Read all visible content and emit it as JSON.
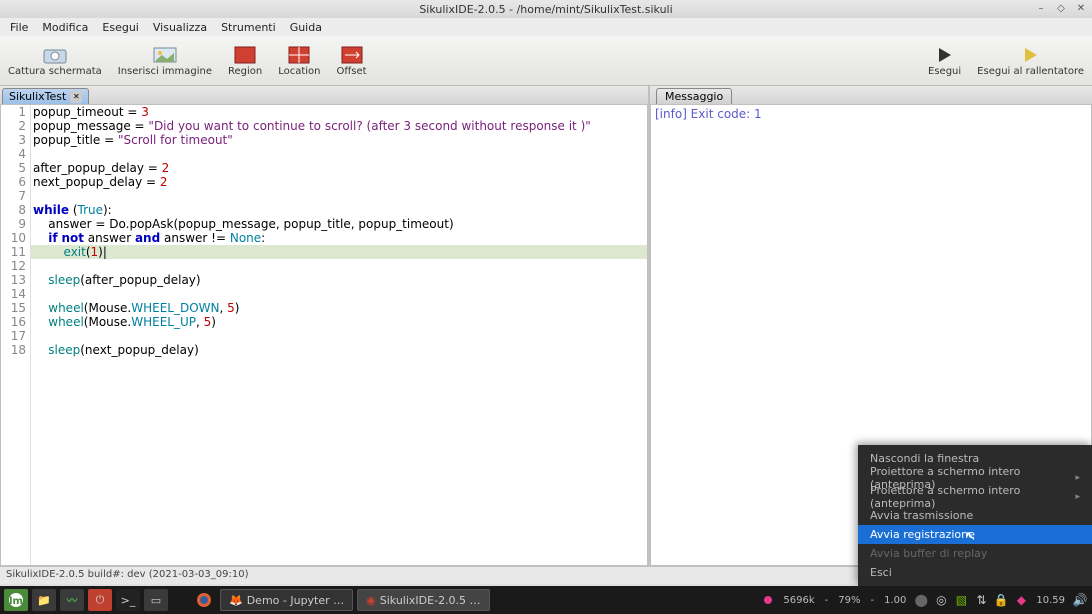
{
  "window": {
    "title": "SikulixIDE-2.0.5 - /home/mint/SikulixTest.sikuli"
  },
  "menubar": [
    "File",
    "Modifica",
    "Esegui",
    "Visualizza",
    "Strumenti",
    "Guida"
  ],
  "toolbar": {
    "capture": "Cattura schermata",
    "insert": "Inserisci immagine",
    "region": "Region",
    "location": "Location",
    "offset": "Offset",
    "run": "Esegui",
    "runslow": "Esegui al rallentatore"
  },
  "tabs": {
    "editor": "SikulixTest",
    "message": "Messaggio"
  },
  "code": {
    "lines": [
      {
        "n": 1,
        "t": [
          [
            "",
            "popup_timeout = "
          ],
          [
            "num",
            "3"
          ]
        ]
      },
      {
        "n": 2,
        "t": [
          [
            "",
            "popup_message = "
          ],
          [
            "str",
            "\"Did you want to continue to scroll? (after 3 second without response it )\""
          ]
        ]
      },
      {
        "n": 3,
        "t": [
          [
            "",
            "popup_title = "
          ],
          [
            "str",
            "\"Scroll for timeout\""
          ]
        ]
      },
      {
        "n": 4,
        "t": [
          [
            "",
            ""
          ]
        ]
      },
      {
        "n": 5,
        "t": [
          [
            "",
            "after_popup_delay = "
          ],
          [
            "num",
            "2"
          ]
        ]
      },
      {
        "n": 6,
        "t": [
          [
            "",
            "next_popup_delay = "
          ],
          [
            "num",
            "2"
          ]
        ]
      },
      {
        "n": 7,
        "t": [
          [
            "",
            ""
          ]
        ]
      },
      {
        "n": 8,
        "t": [
          [
            "kw",
            "while"
          ],
          [
            "",
            " ("
          ],
          [
            "const",
            "True"
          ],
          [
            "",
            "):"
          ]
        ]
      },
      {
        "n": 9,
        "t": [
          [
            "",
            "    answer = Do.popAsk(popup_message, popup_title, popup_timeout)"
          ]
        ]
      },
      {
        "n": 10,
        "t": [
          [
            "",
            "    "
          ],
          [
            "kw",
            "if"
          ],
          [
            "",
            " "
          ],
          [
            "kw",
            "not"
          ],
          [
            "",
            " answer "
          ],
          [
            "kw",
            "and"
          ],
          [
            "",
            " answer != "
          ],
          [
            "const",
            "None"
          ],
          [
            "",
            ":"
          ]
        ]
      },
      {
        "n": 11,
        "t": [
          [
            "",
            "        "
          ],
          [
            "fn",
            "exit"
          ],
          [
            "",
            "("
          ],
          [
            "num",
            "1"
          ],
          [
            "",
            ")|"
          ]
        ],
        "hl": true
      },
      {
        "n": 12,
        "t": [
          [
            "",
            ""
          ]
        ]
      },
      {
        "n": 13,
        "t": [
          [
            "",
            "    "
          ],
          [
            "fn",
            "sleep"
          ],
          [
            "",
            "(after_popup_delay)"
          ]
        ]
      },
      {
        "n": 14,
        "t": [
          [
            "",
            ""
          ]
        ]
      },
      {
        "n": 15,
        "t": [
          [
            "",
            "    "
          ],
          [
            "fn",
            "wheel"
          ],
          [
            "",
            "(Mouse."
          ],
          [
            "const",
            "WHEEL_DOWN"
          ],
          [
            "",
            ", "
          ],
          [
            "num",
            "5"
          ],
          [
            "",
            ")"
          ]
        ]
      },
      {
        "n": 16,
        "t": [
          [
            "",
            "    "
          ],
          [
            "fn",
            "wheel"
          ],
          [
            "",
            "(Mouse."
          ],
          [
            "const",
            "WHEEL_UP"
          ],
          [
            "",
            ", "
          ],
          [
            "num",
            "5"
          ],
          [
            "",
            ")"
          ]
        ]
      },
      {
        "n": 17,
        "t": [
          [
            "",
            ""
          ]
        ]
      },
      {
        "n": 18,
        "t": [
          [
            "",
            "    "
          ],
          [
            "fn",
            "sleep"
          ],
          [
            "",
            "(next_popup_delay)"
          ]
        ]
      }
    ]
  },
  "message_output": "[info] Exit code: 1",
  "statusbar": "SikulixIDE-2.0.5 build#: dev (2021-03-03_09:10)",
  "context_menu": {
    "items": [
      {
        "label": "Nascondi la finestra"
      },
      {
        "label": "Proiettore a schermo intero (anteprima)",
        "arrow": true
      },
      {
        "label": "Proiettore a schermo intero (anteprima)",
        "arrow": true
      },
      {
        "label": "Avvia trasmissione"
      },
      {
        "label": "Avvia registrazione",
        "selected": true
      },
      {
        "label": "Avvia buffer di replay",
        "disabled": true
      },
      {
        "label": "Esci"
      }
    ]
  },
  "taskbar": {
    "tasks": [
      {
        "label": "Demo - Jupyter …",
        "icon": "firefox"
      },
      {
        "label": "SikulixIDE-2.0.5 …",
        "icon": "sikuli",
        "active": true
      }
    ],
    "tray": {
      "net": "5696k",
      "cpu": "79%",
      "load": "1.00",
      "time": "10.59"
    }
  }
}
